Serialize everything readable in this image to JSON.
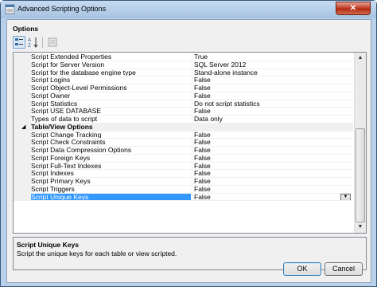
{
  "window": {
    "title": "Advanced Scripting Options",
    "close_label": "✕"
  },
  "options": {
    "heading": "Options"
  },
  "toolbar": {
    "categorized_icon": "categorized-icon",
    "alphabetical_icon": "alphabetical-sort-icon",
    "property_pages_icon": "property-pages-icon"
  },
  "grid": {
    "rows": [
      {
        "type": "item",
        "name": "Script Extended Properties",
        "value": "True"
      },
      {
        "type": "item",
        "name": "Script for Server Version",
        "value": "SQL Server 2012"
      },
      {
        "type": "item",
        "name": "Script for the database engine type",
        "value": "Stand-alone instance"
      },
      {
        "type": "item",
        "name": "Script Logins",
        "value": "False"
      },
      {
        "type": "item",
        "name": "Script Object-Level Permissions",
        "value": "False"
      },
      {
        "type": "item",
        "name": "Script Owner",
        "value": "False"
      },
      {
        "type": "item",
        "name": "Script Statistics",
        "value": "Do not script statistics"
      },
      {
        "type": "item",
        "name": "Script USE DATABASE",
        "value": "False"
      },
      {
        "type": "item",
        "name": "Types of data to script",
        "value": "Data only"
      },
      {
        "type": "category",
        "name": "Table/View Options",
        "value": ""
      },
      {
        "type": "item",
        "name": "Script Change Tracking",
        "value": "False"
      },
      {
        "type": "item",
        "name": "Script Check Constraints",
        "value": "False"
      },
      {
        "type": "item",
        "name": "Script Data Compression Options",
        "value": "False"
      },
      {
        "type": "item",
        "name": "Script Foreign Keys",
        "value": "False"
      },
      {
        "type": "item",
        "name": "Script Full-Text Indexes",
        "value": "False"
      },
      {
        "type": "item",
        "name": "Script Indexes",
        "value": "False"
      },
      {
        "type": "item",
        "name": "Script Primary Keys",
        "value": "False"
      },
      {
        "type": "item",
        "name": "Script Triggers",
        "value": "False"
      },
      {
        "type": "item",
        "name": "Script Unique Keys",
        "value": "False",
        "selected": true
      }
    ],
    "collapse_glyph": "◢",
    "dropdown_glyph": "▼"
  },
  "description": {
    "title": "Script Unique Keys",
    "text": "Script the unique keys for each table or view scripted."
  },
  "buttons": {
    "ok": "OK",
    "cancel": "Cancel"
  },
  "colors": {
    "selection": "#3399ff",
    "window_frame": "#b9d1ea",
    "close_button": "#c3432c"
  }
}
